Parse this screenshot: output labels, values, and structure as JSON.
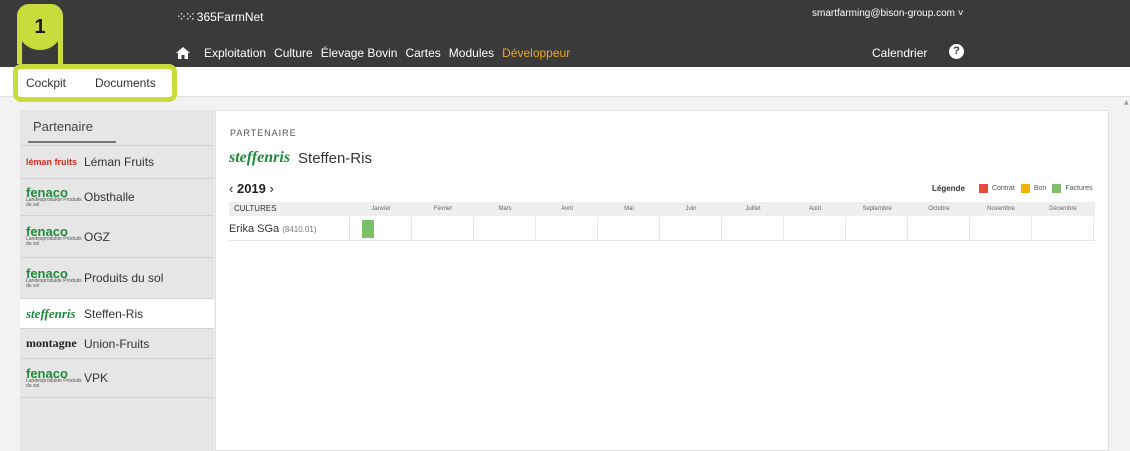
{
  "header": {
    "app_name": "365FarmNet",
    "user_email": "smartfarming@bison-group.com ˅",
    "nav_items": [
      "Exploitation",
      "Culture",
      "Élevage Bovin",
      "Cartes",
      "Modules",
      "Développeur"
    ],
    "active_nav": "Développeur",
    "calendar_label": "Calendrier",
    "help_label": "?"
  },
  "badge": {
    "number": "1"
  },
  "subtabs": [
    "Cockpit",
    "Documents"
  ],
  "sidebar": {
    "title": "Partenaire",
    "partners": [
      {
        "name": "Léman Fruits",
        "logo": "leman-fruits",
        "logo_text": "léman fruits"
      },
      {
        "name": "Obsthalle",
        "logo": "fenaco",
        "logo_text": "fenaco",
        "logo_sub": "Landesprodukte Produits du sol"
      },
      {
        "name": "OGZ",
        "logo": "fenaco",
        "logo_text": "fenaco",
        "logo_sub": "Landesprodukte Produits du sol"
      },
      {
        "name": "Produits du sol",
        "logo": "fenaco",
        "logo_text": "fenaco",
        "logo_sub": "Landesprodukte Produits du sol"
      },
      {
        "name": "Steffen-Ris",
        "logo": "steffen-ris",
        "logo_text": "steffenris",
        "active": true
      },
      {
        "name": "Union-Fruits",
        "logo": "la-montagne",
        "logo_text": "montagne"
      },
      {
        "name": "VPK",
        "logo": "fenaco",
        "logo_text": "fenaco",
        "logo_sub": "Landesprodukte Produits du sol"
      }
    ]
  },
  "main": {
    "section_label": "PARTENAIRE",
    "partner_name": "Steffen-Ris",
    "partner_logo_text": "steffenris",
    "year": "2019",
    "prev_arrow": "‹",
    "next_arrow": "›",
    "legend": {
      "title": "Légende",
      "items": [
        {
          "label": "Contrat",
          "color": "#e8493a"
        },
        {
          "label": "Bon",
          "color": "#f0b400"
        },
        {
          "label": "Factures",
          "color": "#7dbf6b"
        }
      ]
    },
    "table": {
      "first_column": "CULTURES",
      "months": [
        "Janvier",
        "Février",
        "Mars",
        "Avril",
        "Mai",
        "Juin",
        "Juillet",
        "Août",
        "Septembre",
        "Octobre",
        "Novembre",
        "Décembre"
      ],
      "rows": [
        {
          "culture": "Erika SGa",
          "code": "(8410.01)",
          "bars": [
            {
              "month": "Janvier",
              "type": "Factures"
            }
          ]
        }
      ]
    }
  }
}
